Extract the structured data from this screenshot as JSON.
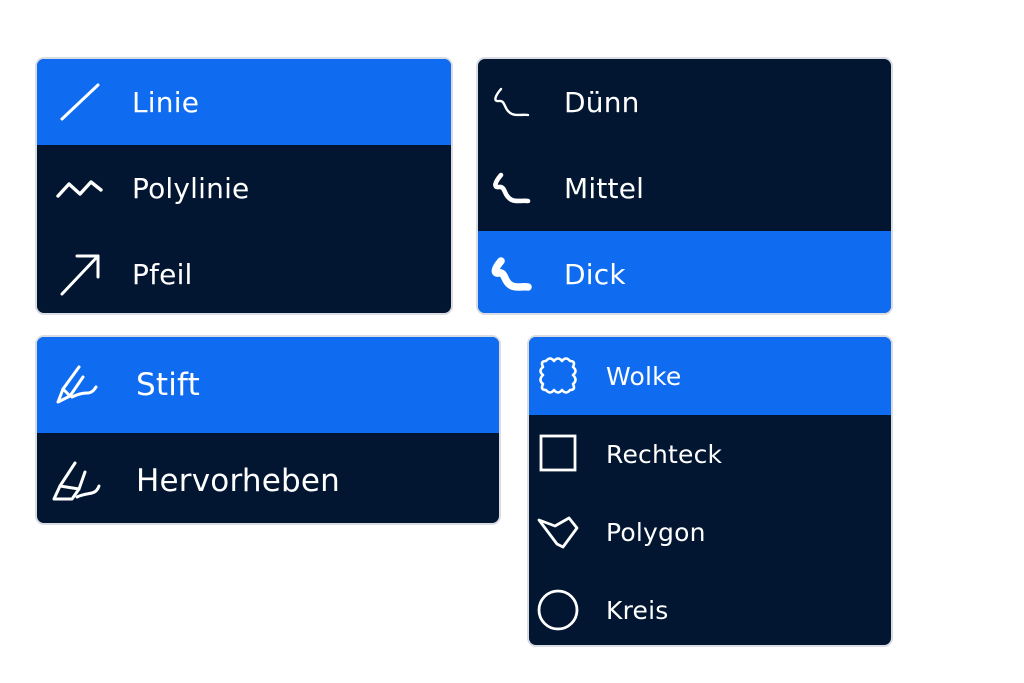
{
  "colors": {
    "menu_background": "#021631",
    "selected_background": "#0f6cf0",
    "text": "#ffffff",
    "border": "#d9dde3"
  },
  "line_menu": {
    "items": [
      {
        "label": "Linie",
        "icon": "line-icon",
        "selected": true
      },
      {
        "label": "Polylinie",
        "icon": "polyline-icon",
        "selected": false
      },
      {
        "label": "Pfeil",
        "icon": "arrow-icon",
        "selected": false
      }
    ]
  },
  "width_menu": {
    "items": [
      {
        "label": "Dünn",
        "icon": "stroke-thin-icon",
        "selected": false
      },
      {
        "label": "Mittel",
        "icon": "stroke-medium-icon",
        "selected": false
      },
      {
        "label": "Dick",
        "icon": "stroke-thick-icon",
        "selected": true
      }
    ]
  },
  "pen_menu": {
    "items": [
      {
        "label": "Stift",
        "icon": "pen-icon",
        "selected": true
      },
      {
        "label": "Hervorheben",
        "icon": "highlighter-icon",
        "selected": false
      }
    ]
  },
  "shape_menu": {
    "items": [
      {
        "label": "Wolke",
        "icon": "cloud-icon",
        "selected": true
      },
      {
        "label": "Rechteck",
        "icon": "rectangle-icon",
        "selected": false
      },
      {
        "label": "Polygon",
        "icon": "polygon-icon",
        "selected": false
      },
      {
        "label": "Kreis",
        "icon": "circle-icon",
        "selected": false
      }
    ]
  }
}
